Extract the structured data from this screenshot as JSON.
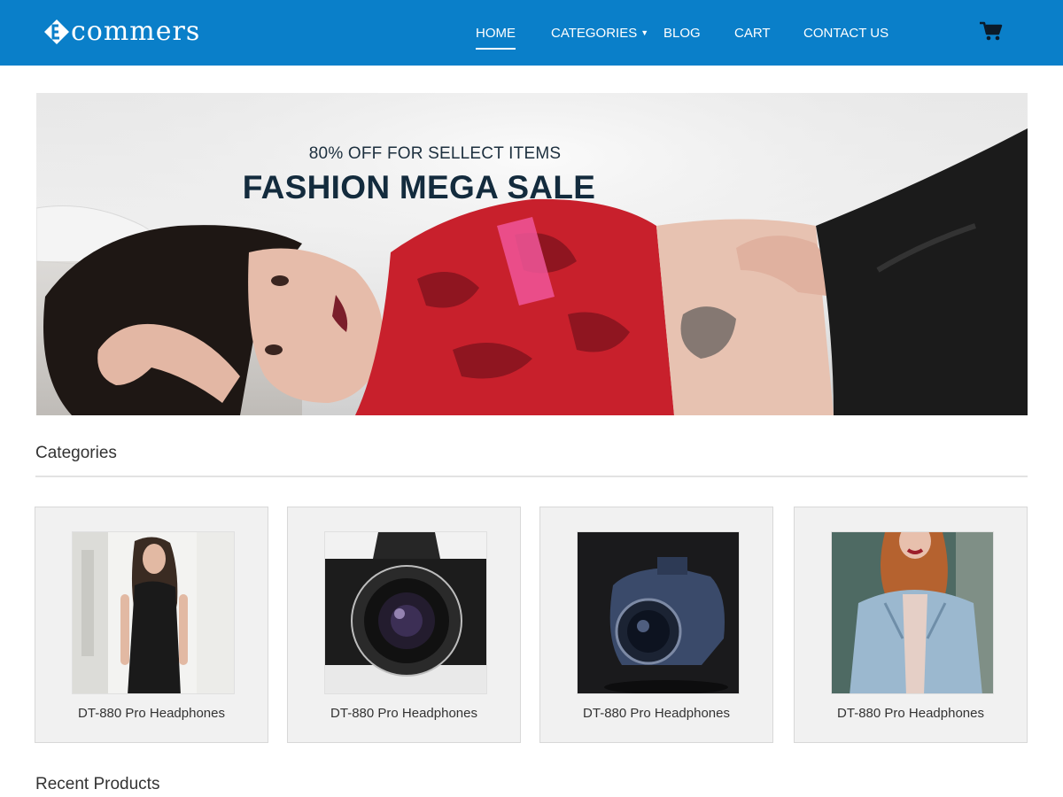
{
  "brand": {
    "name": "commers"
  },
  "nav": {
    "items": [
      {
        "label": "HOME",
        "active": true
      },
      {
        "label": "CATEGORIES",
        "has_dropdown": true
      },
      {
        "label": "BLOG"
      },
      {
        "label": "CART"
      },
      {
        "label": "CONTACT US"
      }
    ],
    "cart_icon": "shopping-cart-icon"
  },
  "hero": {
    "subtitle": "80% OFF FOR SELLECT ITEMS",
    "title": "FASHION MEGA SALE"
  },
  "categories": {
    "heading": "Categories",
    "items": [
      {
        "label": "DT-880 Pro Headphones",
        "image": "woman-black-dress"
      },
      {
        "label": "DT-880 Pro Headphones",
        "image": "vintage-camera"
      },
      {
        "label": "DT-880 Pro Headphones",
        "image": "dslr-camera"
      },
      {
        "label": "DT-880 Pro Headphones",
        "image": "woman-denim-jacket"
      }
    ]
  },
  "recent": {
    "heading": "Recent Products"
  },
  "colors": {
    "header": "#0a7fc9",
    "title": "#132b3d",
    "text": "#333333"
  }
}
